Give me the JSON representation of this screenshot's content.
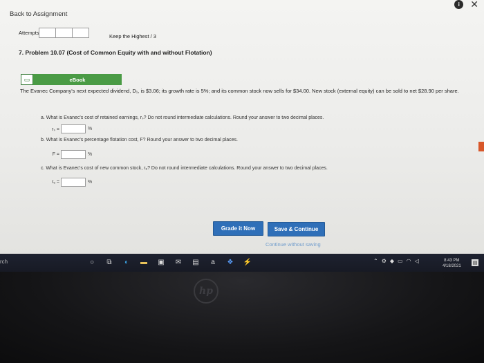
{
  "nav": {
    "back_label": "Back to Assignment"
  },
  "top_icons": {
    "info": "info-icon",
    "close": "close-icon",
    "close_glyph": "✕"
  },
  "attempts": {
    "label": "Attempts",
    "keep_highest": "Keep the Highest / 3"
  },
  "problem": {
    "title": "7. Problem 10.07 (Cost of Common Equity with and without Flotation)",
    "ebook_label": "eBook",
    "text": "The Evanec Company's next expected dividend, D₁, is $3.06; its growth rate is 5%; and its common stock now sells for $34.00. New stock (external equity) can be sold to net $28.90 per share.",
    "questions": [
      {
        "text": "a. What is Evanec's cost of retained earnings, rₛ? Do not round intermediate calculations. Round your answer to two decimal places.",
        "answer_label": "rₛ =",
        "value": "",
        "unit": "%"
      },
      {
        "text": "b. What is Evanec's percentage flotation cost, F? Round your answer to two decimal places.",
        "answer_label": "F =",
        "value": "",
        "unit": "%"
      },
      {
        "text": "c. What is Evanec's cost of new common stock, rₑ? Do not round intermediate calculations. Round your answer to two decimal places.",
        "answer_label": "rₑ =",
        "value": "",
        "unit": "%"
      }
    ]
  },
  "actions": {
    "grade_now": "Grade it Now",
    "save_continue": "Save & Continue",
    "continue_without_saving": "Continue without saving"
  },
  "taskbar": {
    "search_stub": "rch",
    "clock_time": "8:43 PM",
    "clock_date": "4/18/2021"
  },
  "colors": {
    "accent": "#2f6fb8",
    "ebook_green": "#4a9b45"
  }
}
